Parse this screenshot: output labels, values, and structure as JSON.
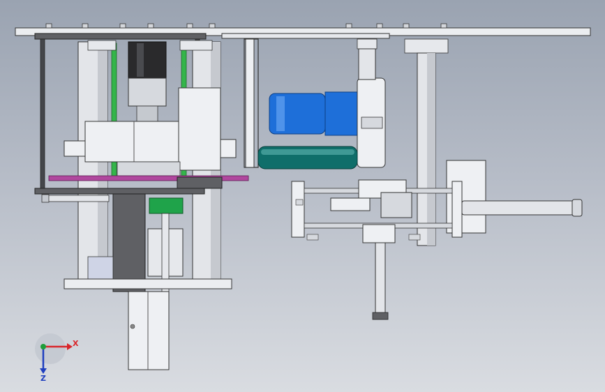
{
  "viewport": {
    "view_name": "front-orthographic",
    "background_top": "#9aa3b1",
    "background_bottom": "#d9dce1"
  },
  "triad": {
    "x_label": "X",
    "z_label": "Z",
    "x_color": "#d9252a",
    "y_color": "#1e9e3a",
    "z_color": "#1f3fbf"
  },
  "assembly": {
    "colors": {
      "steel": "#e6e8ec",
      "steel_shade": "#b9bdc5",
      "dark_plate": "#5f6064",
      "motor_black": "#2a2a2c",
      "blue_motor": "#1e6fd9",
      "teal_roller": "#0f6e6a",
      "magenta_disc": "#b0479e",
      "green_rail": "#34b54a",
      "green_block": "#1fa34a"
    }
  }
}
